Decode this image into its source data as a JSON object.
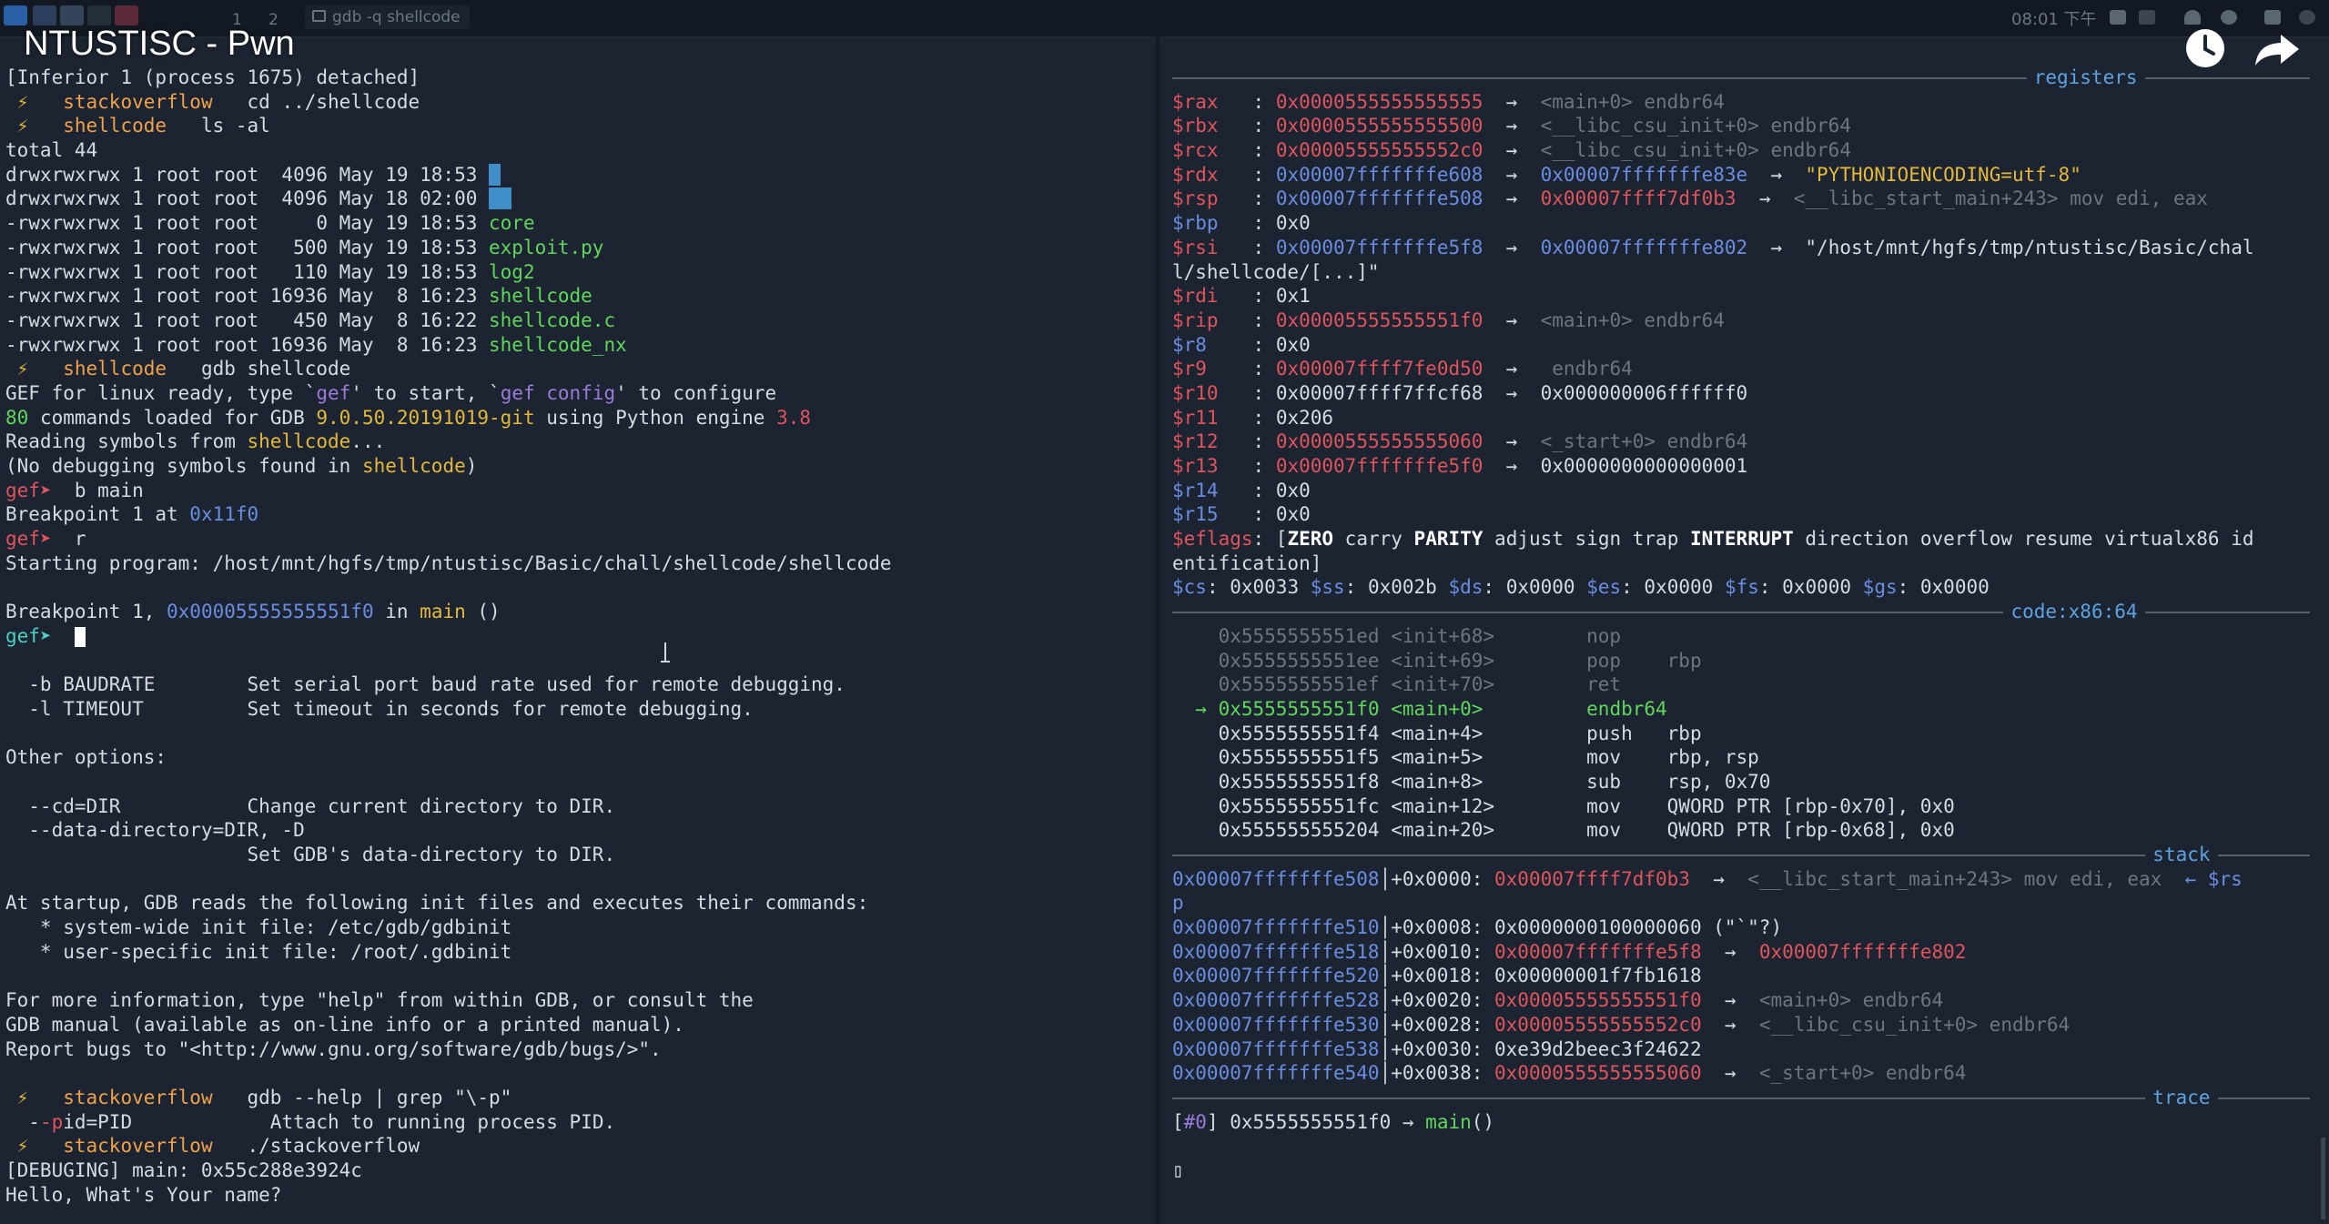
{
  "video_title": "NTUSTISC - Pwn",
  "topbar": {
    "workspace_1": "1",
    "workspace_2": "2",
    "window_title": "gdb -q shellcode",
    "clock": "08:01 下午"
  },
  "left_terminal": [
    {
      "t": "[Inferior 1 (process 1675) detached]",
      "c": ""
    },
    {
      "segs": [
        {
          "t": " ⚡ ",
          "c": "yl"
        },
        {
          "t": "  stackoverflow ",
          "c": "or"
        },
        {
          "t": "  cd ../shellcode",
          "c": ""
        }
      ]
    },
    {
      "segs": [
        {
          "t": " ⚡ ",
          "c": "yl"
        },
        {
          "t": "  shellcode ",
          "c": "or"
        },
        {
          "t": "  ls -al",
          "c": ""
        }
      ]
    },
    {
      "t": "total 44",
      "c": ""
    },
    {
      "segs": [
        {
          "t": "drwxrwxrwx 1 root root  4096 May 19 18:53 ",
          "c": ""
        },
        {
          "t": ".",
          "c": "hl"
        }
      ]
    },
    {
      "segs": [
        {
          "t": "drwxrwxrwx 1 root root  4096 May 18 02:00 ",
          "c": ""
        },
        {
          "t": "..",
          "c": "hl"
        }
      ]
    },
    {
      "segs": [
        {
          "t": "-rwxrwxrwx 1 root root     0 May 19 18:53 ",
          "c": ""
        },
        {
          "t": "core",
          "c": "gn"
        }
      ]
    },
    {
      "segs": [
        {
          "t": "-rwxrwxrwx 1 root root   500 May 19 18:53 ",
          "c": ""
        },
        {
          "t": "exploit.py",
          "c": "gn"
        }
      ]
    },
    {
      "segs": [
        {
          "t": "-rwxrwxrwx 1 root root   110 May 19 18:53 ",
          "c": ""
        },
        {
          "t": "log2",
          "c": "gn"
        }
      ]
    },
    {
      "segs": [
        {
          "t": "-rwxrwxrwx 1 root root 16936 May  8 16:23 ",
          "c": ""
        },
        {
          "t": "shellcode",
          "c": "gn"
        }
      ]
    },
    {
      "segs": [
        {
          "t": "-rwxrwxrwx 1 root root   450 May  8 16:22 ",
          "c": ""
        },
        {
          "t": "shellcode.c",
          "c": "gn"
        }
      ]
    },
    {
      "segs": [
        {
          "t": "-rwxrwxrwx 1 root root 16936 May  8 16:23 ",
          "c": ""
        },
        {
          "t": "shellcode_nx",
          "c": "gn"
        }
      ]
    },
    {
      "segs": [
        {
          "t": " ⚡ ",
          "c": "yl"
        },
        {
          "t": "  shellcode ",
          "c": "or"
        },
        {
          "t": "  gdb shellcode",
          "c": ""
        }
      ]
    },
    {
      "segs": [
        {
          "t": "GEF for linux ready, type `",
          "c": ""
        },
        {
          "t": "gef",
          "c": "pu"
        },
        {
          "t": "' to start, `",
          "c": ""
        },
        {
          "t": "gef config",
          "c": "pu"
        },
        {
          "t": "' to configure",
          "c": ""
        }
      ]
    },
    {
      "segs": [
        {
          "t": "80",
          "c": "gn"
        },
        {
          "t": " commands loaded for GDB ",
          "c": ""
        },
        {
          "t": "9.0.50.20191019-git",
          "c": "yl"
        },
        {
          "t": " using Python engine ",
          "c": ""
        },
        {
          "t": "3.8",
          "c": "rd"
        }
      ]
    },
    {
      "segs": [
        {
          "t": "Reading symbols from ",
          "c": ""
        },
        {
          "t": "shellcode",
          "c": "yl"
        },
        {
          "t": "...",
          "c": ""
        }
      ]
    },
    {
      "segs": [
        {
          "t": "(No debugging symbols found in ",
          "c": ""
        },
        {
          "t": "shellcode",
          "c": "yl"
        },
        {
          "t": ")",
          "c": ""
        }
      ]
    },
    {
      "segs": [
        {
          "t": "gef➤ ",
          "c": "rd"
        },
        {
          "t": " b main",
          "c": ""
        }
      ]
    },
    {
      "segs": [
        {
          "t": "Breakpoint 1 at ",
          "c": ""
        },
        {
          "t": "0x11f0",
          "c": "bl"
        }
      ]
    },
    {
      "segs": [
        {
          "t": "gef➤ ",
          "c": "rd"
        },
        {
          "t": " r",
          "c": ""
        }
      ]
    },
    {
      "t": "Starting program: /host/mnt/hgfs/tmp/ntustisc/Basic/chall/shellcode/shellcode",
      "c": ""
    },
    {
      "t": "",
      "c": ""
    },
    {
      "segs": [
        {
          "t": "Breakpoint 1, ",
          "c": ""
        },
        {
          "t": "0x00005555555551f0",
          "c": "bl"
        },
        {
          "t": " in ",
          "c": ""
        },
        {
          "t": "main",
          "c": "yl"
        },
        {
          "t": " ()",
          "c": ""
        }
      ]
    },
    {
      "segs": [
        {
          "t": "gef➤ ",
          "c": "cy"
        },
        {
          "t": " ",
          "c": ""
        }
      ],
      "cursor": true
    },
    {
      "t": "",
      "c": ""
    },
    {
      "t": "  -b BAUDRATE        Set serial port baud rate used for remote debugging.",
      "c": ""
    },
    {
      "t": "  -l TIMEOUT         Set timeout in seconds for remote debugging.",
      "c": ""
    },
    {
      "t": "",
      "c": ""
    },
    {
      "t": "Other options:",
      "c": ""
    },
    {
      "t": "",
      "c": ""
    },
    {
      "t": "  --cd=DIR           Change current directory to DIR.",
      "c": ""
    },
    {
      "t": "  --data-directory=DIR, -D",
      "c": ""
    },
    {
      "t": "                     Set GDB's data-directory to DIR.",
      "c": ""
    },
    {
      "t": "",
      "c": ""
    },
    {
      "t": "At startup, GDB reads the following init files and executes their commands:",
      "c": ""
    },
    {
      "t": "   * system-wide init file: /etc/gdb/gdbinit",
      "c": ""
    },
    {
      "t": "   * user-specific init file: /root/.gdbinit",
      "c": ""
    },
    {
      "t": "",
      "c": ""
    },
    {
      "t": "For more information, type \"help\" from within GDB, or consult the",
      "c": ""
    },
    {
      "t": "GDB manual (available as on-line info or a printed manual).",
      "c": ""
    },
    {
      "t": "Report bugs to \"<http://www.gnu.org/software/gdb/bugs/>\".",
      "c": ""
    },
    {
      "t": "",
      "c": ""
    },
    {
      "segs": [
        {
          "t": " ⚡ ",
          "c": "yl"
        },
        {
          "t": "  stackoverflow ",
          "c": "or"
        },
        {
          "t": "  gdb --help | grep \"\\-p\"",
          "c": ""
        }
      ]
    },
    {
      "segs": [
        {
          "t": "  -",
          "c": ""
        },
        {
          "t": "-p",
          "c": "rd"
        },
        {
          "t": "id=PID            Attach to running process PID.",
          "c": ""
        }
      ]
    },
    {
      "segs": [
        {
          "t": " ⚡ ",
          "c": "yl"
        },
        {
          "t": "  stackoverflow ",
          "c": "or"
        },
        {
          "t": "  ./stackoverflow",
          "c": ""
        }
      ]
    },
    {
      "t": "[DEBUGING] main: 0x55c288e3924c",
      "c": ""
    },
    {
      "t": "Hello, What's Your name?",
      "c": ""
    }
  ],
  "right_terminal": [
    {
      "sep": "registers"
    },
    {
      "segs": [
        {
          "t": "$rax   ",
          "c": "rd"
        },
        {
          "t": ": ",
          "c": ""
        },
        {
          "t": "0x0000555555555555",
          "c": "rd"
        },
        {
          "t": "  →  ",
          "c": ""
        },
        {
          "t": "<main+0> endbr64",
          "c": "dim"
        }
      ]
    },
    {
      "segs": [
        {
          "t": "$rbx   ",
          "c": "rd"
        },
        {
          "t": ": ",
          "c": ""
        },
        {
          "t": "0x0000555555555500",
          "c": "rd"
        },
        {
          "t": "  →  ",
          "c": ""
        },
        {
          "t": "<__libc_csu_init+0> endbr64",
          "c": "dim"
        }
      ]
    },
    {
      "segs": [
        {
          "t": "$rcx   ",
          "c": "rd"
        },
        {
          "t": ": ",
          "c": ""
        },
        {
          "t": "0x00005555555552c0",
          "c": "rd"
        },
        {
          "t": "  →  ",
          "c": ""
        },
        {
          "t": "<__libc_csu_init+0> endbr64",
          "c": "dim"
        }
      ]
    },
    {
      "segs": [
        {
          "t": "$rdx   ",
          "c": "rd"
        },
        {
          "t": ": ",
          "c": ""
        },
        {
          "t": "0x00007fffffffe608",
          "c": "bl"
        },
        {
          "t": "  →  ",
          "c": ""
        },
        {
          "t": "0x00007fffffffe83e",
          "c": "bl"
        },
        {
          "t": "  →  ",
          "c": ""
        },
        {
          "t": "\"PYTHONIOENCODING=utf-8\"",
          "c": "yl"
        }
      ]
    },
    {
      "segs": [
        {
          "t": "$rsp   ",
          "c": "rd"
        },
        {
          "t": ": ",
          "c": ""
        },
        {
          "t": "0x00007fffffffe508",
          "c": "bl"
        },
        {
          "t": "  →  ",
          "c": ""
        },
        {
          "t": "0x00007ffff7df0b3",
          "c": "rd"
        },
        {
          "t": "  →  ",
          "c": ""
        },
        {
          "t": "<__libc_start_main+243> mov edi, eax",
          "c": "dim"
        }
      ]
    },
    {
      "segs": [
        {
          "t": "$rbp   ",
          "c": "bl"
        },
        {
          "t": ": ",
          "c": ""
        },
        {
          "t": "0x0",
          "c": ""
        }
      ]
    },
    {
      "segs": [
        {
          "t": "$rsi   ",
          "c": "rd"
        },
        {
          "t": ": ",
          "c": ""
        },
        {
          "t": "0x00007fffffffe5f8",
          "c": "bl"
        },
        {
          "t": "  →  ",
          "c": ""
        },
        {
          "t": "0x00007fffffffe802",
          "c": "bl"
        },
        {
          "t": "  →  ",
          "c": ""
        },
        {
          "t": "\"/host/mnt/hgfs/tmp/ntustisc/Basic/chal",
          "c": ""
        }
      ]
    },
    {
      "t": "l/shellcode/[...]\"",
      "c": ""
    },
    {
      "segs": [
        {
          "t": "$rdi   ",
          "c": "rd"
        },
        {
          "t": ": ",
          "c": ""
        },
        {
          "t": "0x1",
          "c": ""
        }
      ]
    },
    {
      "segs": [
        {
          "t": "$rip   ",
          "c": "rd"
        },
        {
          "t": ": ",
          "c": ""
        },
        {
          "t": "0x00005555555551f0",
          "c": "rd"
        },
        {
          "t": "  →  ",
          "c": ""
        },
        {
          "t": "<main+0> endbr64",
          "c": "dim"
        }
      ]
    },
    {
      "segs": [
        {
          "t": "$r8    ",
          "c": "bl"
        },
        {
          "t": ": ",
          "c": ""
        },
        {
          "t": "0x0",
          "c": ""
        }
      ]
    },
    {
      "segs": [
        {
          "t": "$r9    ",
          "c": "rd"
        },
        {
          "t": ": ",
          "c": ""
        },
        {
          "t": "0x00007ffff7fe0d50",
          "c": "rd"
        },
        {
          "t": "  →  ",
          "c": ""
        },
        {
          "t": " endbr64",
          "c": "dim"
        }
      ]
    },
    {
      "segs": [
        {
          "t": "$r10   ",
          "c": "rd"
        },
        {
          "t": ": ",
          "c": ""
        },
        {
          "t": "0x00007ffff7ffcf68",
          "c": ""
        },
        {
          "t": "  →  ",
          "c": ""
        },
        {
          "t": "0x000000006ffffff0",
          "c": ""
        }
      ]
    },
    {
      "segs": [
        {
          "t": "$r11   ",
          "c": "rd"
        },
        {
          "t": ": ",
          "c": ""
        },
        {
          "t": "0x206",
          "c": ""
        }
      ]
    },
    {
      "segs": [
        {
          "t": "$r12   ",
          "c": "rd"
        },
        {
          "t": ": ",
          "c": ""
        },
        {
          "t": "0x0000555555555060",
          "c": "rd"
        },
        {
          "t": "  →  ",
          "c": ""
        },
        {
          "t": "<_start+0> endbr64",
          "c": "dim"
        }
      ]
    },
    {
      "segs": [
        {
          "t": "$r13   ",
          "c": "rd"
        },
        {
          "t": ": ",
          "c": ""
        },
        {
          "t": "0x00007fffffffe5f0",
          "c": "rd"
        },
        {
          "t": "  →  ",
          "c": ""
        },
        {
          "t": "0x0000000000000001",
          "c": ""
        }
      ]
    },
    {
      "segs": [
        {
          "t": "$r14   ",
          "c": "bl"
        },
        {
          "t": ": ",
          "c": ""
        },
        {
          "t": "0x0",
          "c": ""
        }
      ]
    },
    {
      "segs": [
        {
          "t": "$r15   ",
          "c": "bl"
        },
        {
          "t": ": ",
          "c": ""
        },
        {
          "t": "0x0",
          "c": ""
        }
      ]
    },
    {
      "segs": [
        {
          "t": "$eflags",
          "c": "rd"
        },
        {
          "t": ": [",
          "c": ""
        },
        {
          "t": "ZERO",
          "c": "bo"
        },
        {
          "t": " carry ",
          "c": ""
        },
        {
          "t": "PARITY",
          "c": "bo"
        },
        {
          "t": " adjust sign trap ",
          "c": ""
        },
        {
          "t": "INTERRUPT",
          "c": "bo"
        },
        {
          "t": " direction overflow resume virtualx86 id",
          "c": ""
        }
      ]
    },
    {
      "t": "entification]",
      "c": ""
    },
    {
      "segs": [
        {
          "t": "$cs",
          "c": "bl"
        },
        {
          "t": ": 0x0033 ",
          "c": ""
        },
        {
          "t": "$ss",
          "c": "bl"
        },
        {
          "t": ": 0x002b ",
          "c": ""
        },
        {
          "t": "$ds",
          "c": "bl"
        },
        {
          "t": ": 0x0000 ",
          "c": ""
        },
        {
          "t": "$es",
          "c": "bl"
        },
        {
          "t": ": 0x0000 ",
          "c": ""
        },
        {
          "t": "$fs",
          "c": "bl"
        },
        {
          "t": ": 0x0000 ",
          "c": ""
        },
        {
          "t": "$gs",
          "c": "bl"
        },
        {
          "t": ": 0x0000",
          "c": ""
        }
      ]
    },
    {
      "sep": "code:x86:64"
    },
    {
      "t": "    0x5555555551ed <init+68>        nop",
      "c": "dim"
    },
    {
      "t": "    0x5555555551ee <init+69>        pop    rbp",
      "c": "dim"
    },
    {
      "t": "    0x5555555551ef <init+70>        ret",
      "c": "dim"
    },
    {
      "segs": [
        {
          "t": "  → ",
          "c": "gn"
        },
        {
          "t": "0x5555555551f0 <main+0>         endbr64",
          "c": "gn"
        }
      ]
    },
    {
      "t": "    0x5555555551f4 <main+4>         push   rbp",
      "c": ""
    },
    {
      "t": "    0x5555555551f5 <main+5>         mov    rbp, rsp",
      "c": ""
    },
    {
      "t": "    0x5555555551f8 <main+8>         sub    rsp, 0x70",
      "c": ""
    },
    {
      "t": "    0x5555555551fc <main+12>        mov    QWORD PTR [rbp-0x70], 0x0",
      "c": ""
    },
    {
      "t": "    0x555555555204 <main+20>        mov    QWORD PTR [rbp-0x68], 0x0",
      "c": ""
    },
    {
      "sep": "stack"
    },
    {
      "segs": [
        {
          "t": "0x00007fffffffe508",
          "c": "bl"
        },
        {
          "t": "│+0x0000: ",
          "c": ""
        },
        {
          "t": "0x00007ffff7df0b3",
          "c": "rd"
        },
        {
          "t": "  →  ",
          "c": ""
        },
        {
          "t": "<__libc_start_main+243> mov edi, eax",
          "c": "dim"
        },
        {
          "t": "  ← $rs",
          "c": "bl"
        }
      ]
    },
    {
      "t": "p",
      "c": "bl"
    },
    {
      "segs": [
        {
          "t": "0x00007fffffffe510",
          "c": "bl"
        },
        {
          "t": "│+0x0008: ",
          "c": ""
        },
        {
          "t": "0x0000000100000060 (\"`\"?)",
          "c": ""
        }
      ]
    },
    {
      "segs": [
        {
          "t": "0x00007fffffffe518",
          "c": "bl"
        },
        {
          "t": "│+0x0010: ",
          "c": ""
        },
        {
          "t": "0x00007fffffffe5f8",
          "c": "rd"
        },
        {
          "t": "  →  ",
          "c": ""
        },
        {
          "t": "0x00007fffffffe802",
          "c": "rd"
        }
      ]
    },
    {
      "segs": [
        {
          "t": "0x00007fffffffe520",
          "c": "bl"
        },
        {
          "t": "│+0x0018: ",
          "c": ""
        },
        {
          "t": "0x00000001f7fb1618",
          "c": ""
        }
      ]
    },
    {
      "segs": [
        {
          "t": "0x00007fffffffe528",
          "c": "bl"
        },
        {
          "t": "│+0x0020: ",
          "c": ""
        },
        {
          "t": "0x00005555555551f0",
          "c": "rd"
        },
        {
          "t": "  →  ",
          "c": ""
        },
        {
          "t": "<main+0> endbr64",
          "c": "dim"
        }
      ]
    },
    {
      "segs": [
        {
          "t": "0x00007fffffffe530",
          "c": "bl"
        },
        {
          "t": "│+0x0028: ",
          "c": ""
        },
        {
          "t": "0x00005555555552c0",
          "c": "rd"
        },
        {
          "t": "  →  ",
          "c": ""
        },
        {
          "t": "<__libc_csu_init+0> endbr64",
          "c": "dim"
        }
      ]
    },
    {
      "segs": [
        {
          "t": "0x00007fffffffe538",
          "c": "bl"
        },
        {
          "t": "│+0x0030: ",
          "c": ""
        },
        {
          "t": "0xe39d2beec3f24622",
          "c": ""
        }
      ]
    },
    {
      "segs": [
        {
          "t": "0x00007fffffffe540",
          "c": "bl"
        },
        {
          "t": "│+0x0038: ",
          "c": ""
        },
        {
          "t": "0x0000555555555060",
          "c": "rd"
        },
        {
          "t": "  →  ",
          "c": ""
        },
        {
          "t": "<_start+0> endbr64",
          "c": "dim"
        }
      ]
    },
    {
      "sep": "trace"
    },
    {
      "segs": [
        {
          "t": "[",
          "c": ""
        },
        {
          "t": "#0",
          "c": "pu"
        },
        {
          "t": "] 0x5555555551f0 → ",
          "c": ""
        },
        {
          "t": "main",
          "c": "gn"
        },
        {
          "t": "()",
          "c": ""
        }
      ]
    },
    {
      "t": "",
      "c": ""
    },
    {
      "t": "▯",
      "c": ""
    }
  ]
}
